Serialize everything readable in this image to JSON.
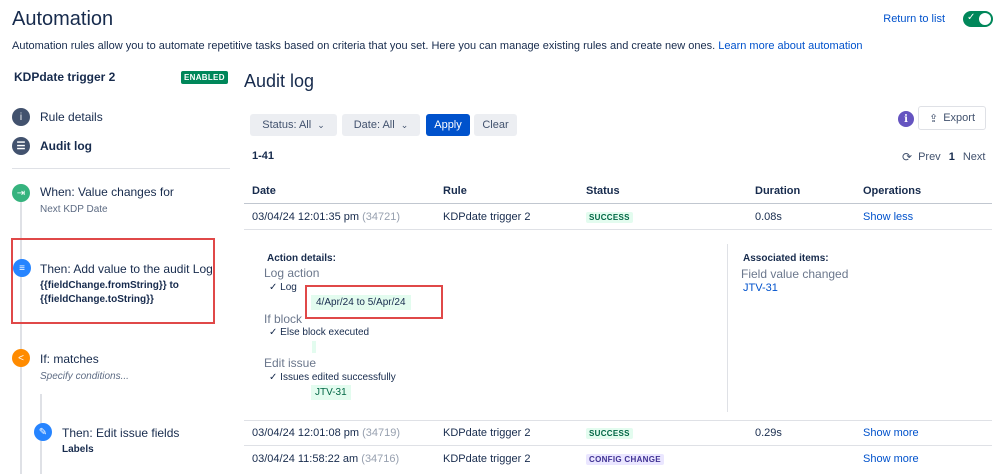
{
  "header": {
    "title": "Automation",
    "description": "Automation rules allow you to automate repetitive tasks based on criteria that you set. Here you can manage existing rules and create new ones.",
    "learn_more": "Learn more about automation",
    "return_link": "Return to list",
    "toggle_on": true
  },
  "sidebar": {
    "rule_name": "KDPdate trigger 2",
    "enabled_badge": "ENABLED",
    "nav": [
      {
        "label": "Rule details",
        "icon": "info-icon"
      },
      {
        "label": "Audit log",
        "icon": "list-icon"
      }
    ],
    "steps": [
      {
        "title": "When: Value changes for",
        "sub": "Next KDP Date",
        "icon": "trigger-icon",
        "color": "#36b37e"
      },
      {
        "title": "Then: Add value to the audit Log",
        "code1": "{{fieldChange.fromString}} to",
        "code2": "{{fieldChange.toString}}",
        "icon": "audit-icon",
        "color": "#2684ff"
      },
      {
        "title": "If: matches",
        "sub": "Specify conditions...",
        "icon": "branch-icon",
        "color": "#ff8b00"
      },
      {
        "title": "Then: Edit issue fields",
        "sub": "Labels",
        "icon": "pencil-icon",
        "color": "#2684ff"
      }
    ]
  },
  "audit": {
    "title": "Audit log",
    "filters": {
      "status": "Status: All",
      "date": "Date: All",
      "apply": "Apply",
      "clear": "Clear"
    },
    "export": "Export",
    "count": "1-41",
    "pagination": {
      "prev": "Prev",
      "page": "1",
      "next": "Next"
    },
    "columns": [
      "Date",
      "Rule",
      "Status",
      "Duration",
      "Operations"
    ],
    "rows": [
      {
        "date": "03/04/24 12:01:35 pm",
        "id": "(34721)",
        "rule": "KDPdate trigger 2",
        "status": "SUCCESS",
        "duration": "0.08s",
        "op": "Show less"
      },
      {
        "date": "03/04/24 12:01:08 pm",
        "id": "(34719)",
        "rule": "KDPdate trigger 2",
        "status": "SUCCESS",
        "duration": "0.29s",
        "op": "Show more"
      },
      {
        "date": "03/04/24 11:58:22 am",
        "id": "(34716)",
        "rule": "KDPdate trigger 2",
        "status": "CONFIG CHANGE",
        "duration": "",
        "op": "Show more"
      }
    ],
    "details": {
      "action_details": "Action details:",
      "log_action": "Log action",
      "log": "Log",
      "log_value": "4/Apr/24 to 5/Apr/24",
      "if_block": "If block",
      "else_executed": "Else block executed",
      "edit_issue": "Edit issue",
      "issues_edited": "Issues edited successfully",
      "issue_key": "JTV-31",
      "associated": "Associated items:",
      "field_changed": "Field value changed",
      "assoc_key": "JTV-31"
    }
  },
  "colors": {
    "primary": "#0052cc",
    "success": "#00875a",
    "highlight": "#e04848"
  }
}
